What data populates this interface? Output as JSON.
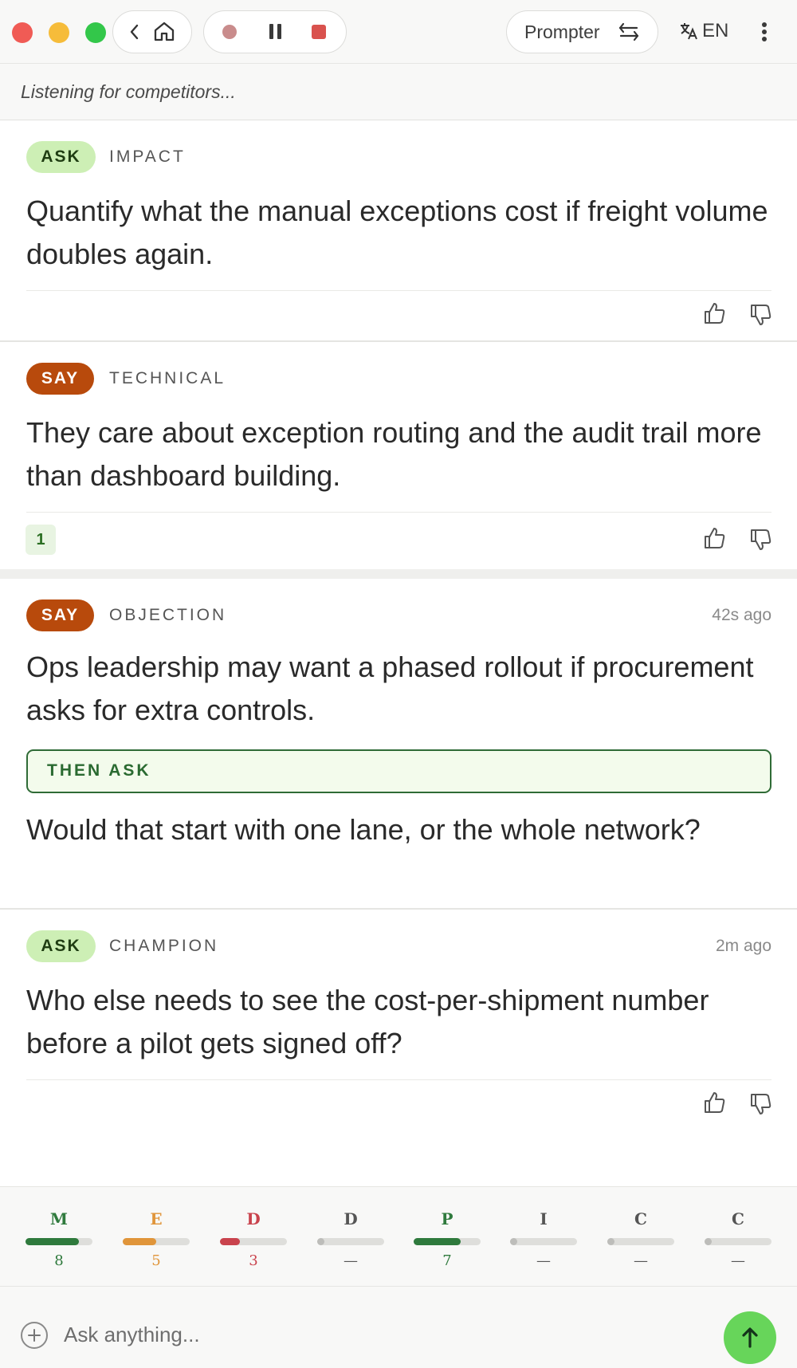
{
  "toolbar": {
    "mode_label": "Prompter",
    "language_label": "EN"
  },
  "status": {
    "text": "Listening for competitors..."
  },
  "cards": [
    {
      "badge": "ASK",
      "category": "IMPACT",
      "text": "Quantify what the manual exceptions cost if freight volume doubles again."
    },
    {
      "badge": "SAY",
      "category": "TECHNICAL",
      "text": "They care about exception routing and the audit trail more than dashboard building.",
      "count": "1"
    },
    {
      "badge": "SAY",
      "category": "OBJECTION",
      "time_ago": "42s ago",
      "text": "Ops leadership may want a phased rollout if procurement asks for extra controls.",
      "followup_label": "THEN ASK",
      "followup_text": "Would that start with one lane, or the whole network?"
    },
    {
      "badge": "ASK",
      "category": "CHAMPION",
      "time_ago": "2m ago",
      "text": "Who else needs to see the cost-per-shipment number before a pilot gets signed off?"
    }
  ],
  "meters": [
    {
      "letter": "M",
      "value": "8",
      "level": 0.8,
      "color": "#2f7a3d"
    },
    {
      "letter": "E",
      "value": "5",
      "level": 0.5,
      "color": "#e0953a"
    },
    {
      "letter": "D",
      "value": "3",
      "level": 0.3,
      "color": "#c9434d"
    },
    {
      "letter": "D",
      "value": "—",
      "level": 0,
      "color": "#555555"
    },
    {
      "letter": "P",
      "value": "7",
      "level": 0.7,
      "color": "#2f7a3d"
    },
    {
      "letter": "I",
      "value": "—",
      "level": 0,
      "color": "#555555"
    },
    {
      "letter": "C",
      "value": "—",
      "level": 0,
      "color": "#555555"
    },
    {
      "letter": "C",
      "value": "—",
      "level": 0,
      "color": "#555555"
    }
  ],
  "composer": {
    "placeholder": "Ask anything..."
  },
  "colors": {
    "ask_badge_bg": "#cdefb5",
    "say_badge_bg": "#b84a0c",
    "send_button": "#67d55a"
  }
}
